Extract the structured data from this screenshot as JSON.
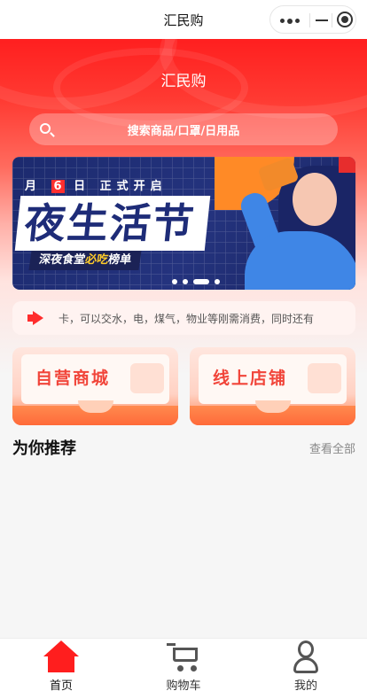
{
  "window": {
    "title": "汇民购"
  },
  "header": {
    "brand": "汇民购"
  },
  "search": {
    "placeholder": "搜索商品/口罩/日用品"
  },
  "banner": {
    "date_line_pre": "月",
    "date_num": "6",
    "date_line_post": "日 正式开启",
    "headline": "夜生活节",
    "tagline_a": "深夜食堂",
    "tagline_hl": "必吃",
    "tagline_b": "榜单",
    "active_slide": 3,
    "slide_count": 4
  },
  "notice": {
    "icon": "megaphone-icon",
    "text": "卡，可以交水，电，煤气，物业等刚需消费，同时还有"
  },
  "entries": [
    {
      "label": "自营商城",
      "icon": "price-tag-icon"
    },
    {
      "label": "线上店铺",
      "icon": "storefront-icon"
    }
  ],
  "recommend": {
    "title": "为你推荐",
    "more": "查看全部"
  },
  "tabbar": {
    "items": [
      {
        "label": "首页",
        "icon": "home-icon",
        "active": true
      },
      {
        "label": "购物车",
        "icon": "cart-icon",
        "active": false
      },
      {
        "label": "我的",
        "icon": "user-icon",
        "active": false
      }
    ]
  },
  "colors": {
    "primary": "#ff1e1e",
    "accent": "#f1453a",
    "banner_bg": "#24337e"
  }
}
